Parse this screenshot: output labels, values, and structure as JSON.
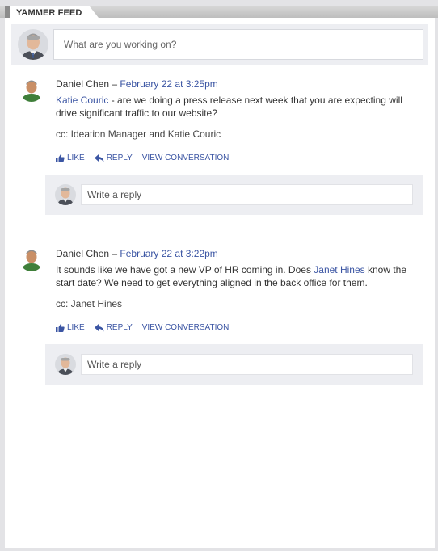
{
  "header": {
    "title": "YAMMER FEED"
  },
  "composer": {
    "placeholder": "What are you working on?"
  },
  "posts": [
    {
      "author": "Daniel Chen",
      "separator": " – ",
      "timestamp": "February 22 at 3:25pm",
      "mention": "Katie Couric",
      "message_after": " - are we doing a press release next week that you are expecting will drive significant traffic to our website?",
      "cc": "cc: Ideation Manager and Katie Couric",
      "actions": {
        "like": "LIKE",
        "reply": "REPLY",
        "view": "VIEW CONVERSATION"
      },
      "reply_placeholder": "Write a reply"
    },
    {
      "author": "Daniel Chen",
      "separator": " – ",
      "timestamp": "February 22 at 3:22pm",
      "message_before": "It sounds like we have got a new VP of HR coming in. Does ",
      "mention": "Janet Hines",
      "message_after": " know the start date? We need to get everything aligned in the back office for them.",
      "cc": "cc: Janet Hines",
      "actions": {
        "like": "LIKE",
        "reply": "REPLY",
        "view": "VIEW CONVERSATION"
      },
      "reply_placeholder": "Write a reply"
    }
  ],
  "colors": {
    "link": "#3b55a3",
    "panel_bg": "#edeef2",
    "frame": "#e3e3e6"
  },
  "icons": {
    "like": "thumbs-up-icon",
    "reply": "reply-arrow-icon"
  }
}
